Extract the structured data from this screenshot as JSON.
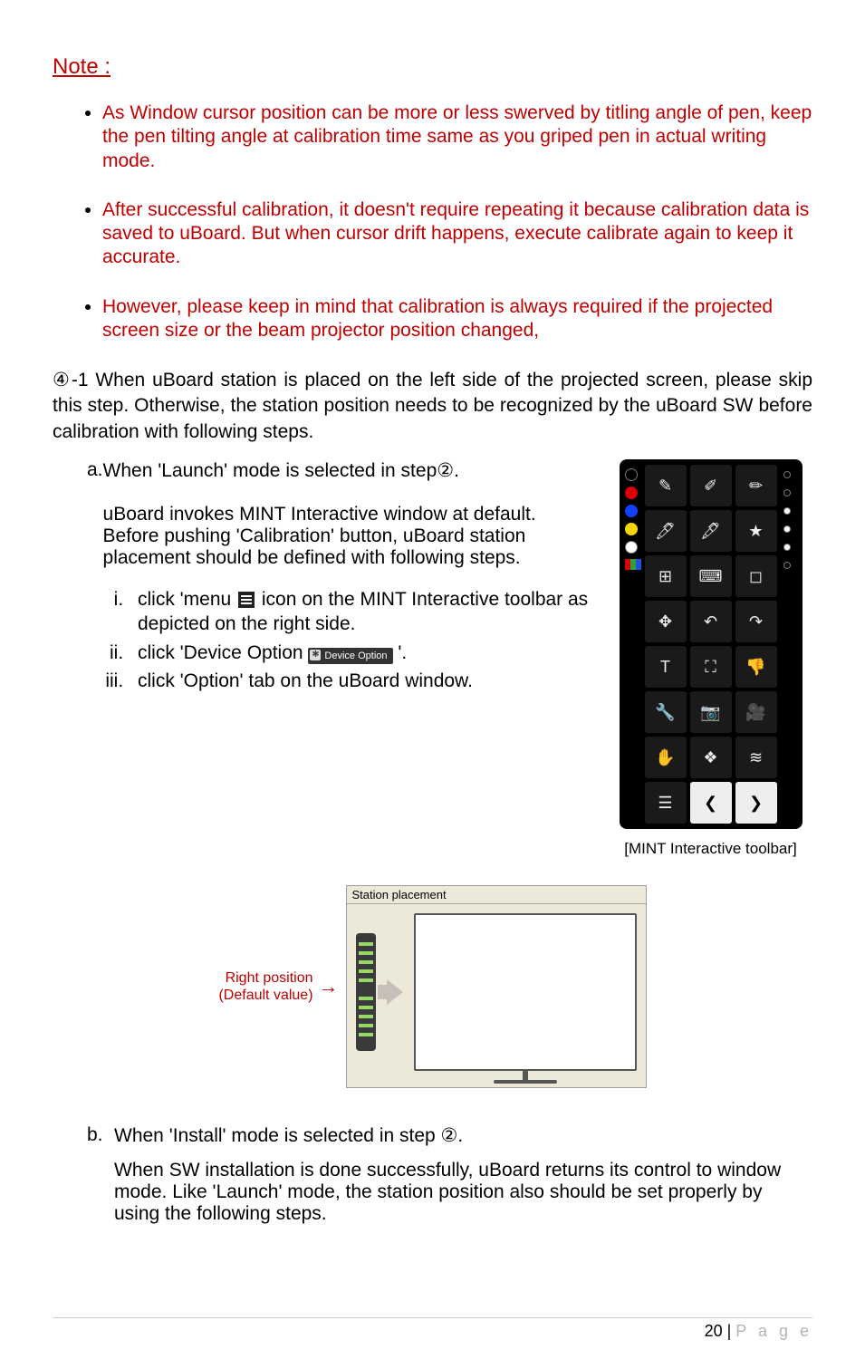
{
  "note_heading": "Note :  ",
  "notes": [
    "As Window cursor position can be more or less swerved by titling angle of pen, keep the pen tilting angle at calibration time same as you griped pen in actual writing mode.",
    "After successful calibration, it doesn't require repeating it because calibration data is saved to uBoard. But when cursor drift happens, execute calibrate again to keep it accurate.",
    "However, please keep in mind that calibration is always required if the projected screen size or the beam projector position changed,"
  ],
  "step41": {
    "prefix": "④-1",
    "body": "  When uBoard station is placed on the left side of the projected screen, please skip this step. Otherwise, the station position needs to be recognized by the uBoard SW before calibration with following steps."
  },
  "step_a": {
    "label": "a.",
    "heading": "When 'Launch' mode is selected in step②.",
    "detail": "uBoard invokes MINT Interactive window at default. Before pushing 'Calibration' button, uBoard station placement should be defined with following steps."
  },
  "roman": {
    "i_pre": "click 'menu ",
    "i_post": " icon on the MINT Interactive toolbar as depicted on the right side.",
    "ii_pre": "click 'Device Option  ",
    "ii_post": " '.",
    "iii": "click 'Option' tab on the uBoard window."
  },
  "device_option_label": "Device Option",
  "toolbar_caption": "[MINT Interactive toolbar]",
  "station": {
    "panel_title": "Station placement",
    "label_line1": "Right position",
    "label_line2": "(Default value)"
  },
  "step_b": {
    "label": "b.",
    "heading": "When 'Install' mode is selected in step ②.",
    "body": "When SW installation is done successfully, uBoard returns its control to window mode. Like 'Launch' mode, the station position also should be set properly by using the following steps."
  },
  "footer": {
    "page_number": "20",
    "sep": " | ",
    "page_word": "P a g e"
  }
}
